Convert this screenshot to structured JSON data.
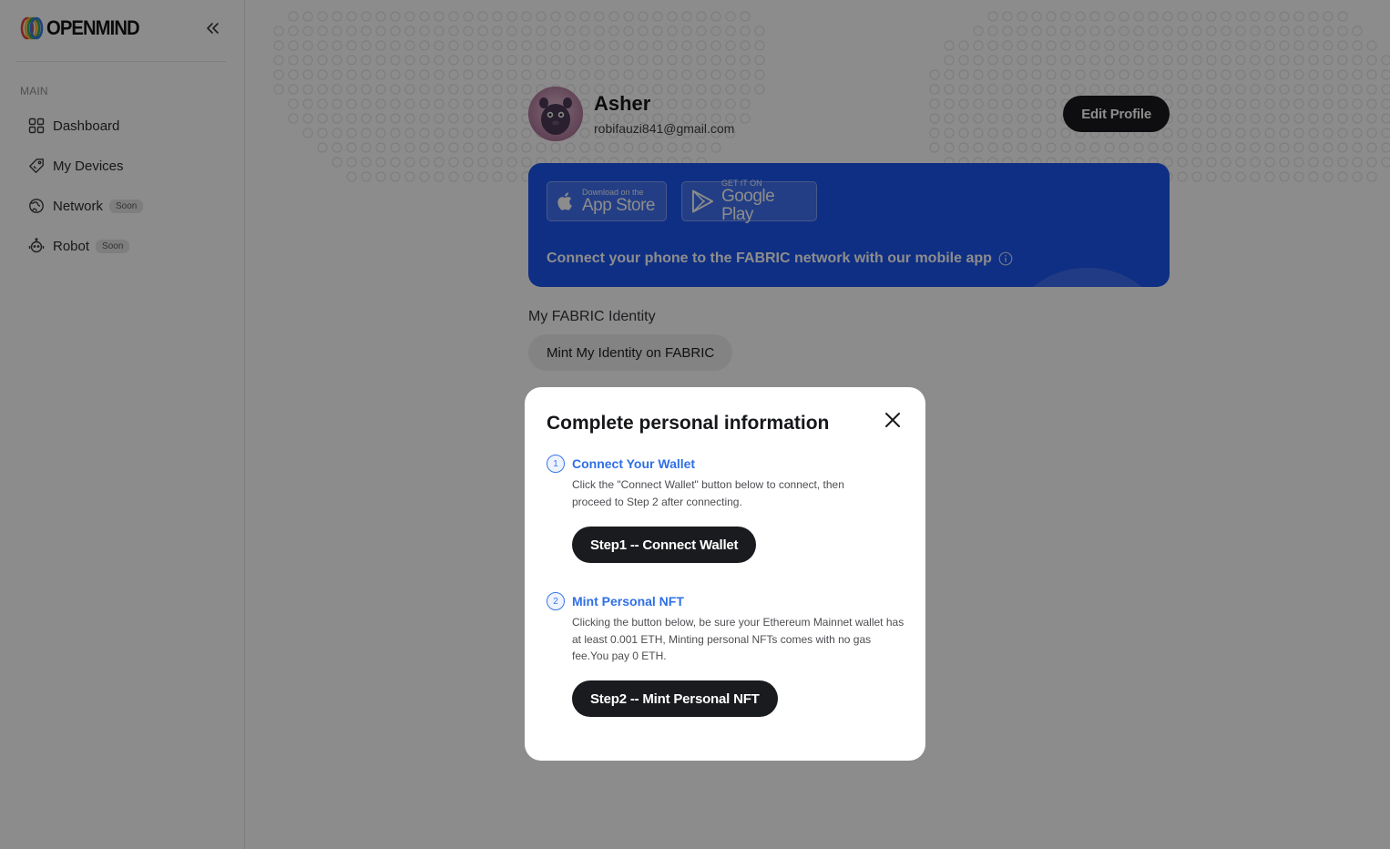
{
  "app": {
    "logo_text": "OPENMIND"
  },
  "sidebar": {
    "section_label": "MAIN",
    "items": [
      {
        "label": "Dashboard",
        "icon": "grid-icon"
      },
      {
        "label": "My Devices",
        "icon": "device-tag-icon"
      },
      {
        "label": "Network",
        "icon": "network-globe-icon",
        "badge": "Soon"
      },
      {
        "label": "Robot",
        "icon": "robot-icon",
        "badge": "Soon"
      }
    ]
  },
  "profile": {
    "name": "Asher",
    "email": "robifauzi841@gmail.com",
    "edit_label": "Edit Profile"
  },
  "app_banner": {
    "apple_small": "Download on the",
    "apple_big": "App Store",
    "google_small": "GET IT ON",
    "google_big": "Google Play",
    "text": "Connect your phone to the FABRIC network with our mobile app",
    "color": "#1d57f0"
  },
  "identity": {
    "title": "My FABRIC Identity",
    "mint_button": "Mint My Identity on FABRIC"
  },
  "modal": {
    "title": "Complete personal information",
    "steps": [
      {
        "number": "1",
        "title": "Connect Your Wallet",
        "description": "Click the \"Connect Wallet\" button below to connect, then proceed to Step 2 after connecting.",
        "button": "Step1 -- Connect Wallet"
      },
      {
        "number": "2",
        "title": "Mint Personal NFT",
        "description": "Clicking the button below, be sure your Ethereum Mainnet wallet has at least 0.001 ETH, Minting personal NFTs comes with no gas fee.You pay 0 ETH.",
        "button": "Step2 -- Mint Personal NFT"
      }
    ]
  }
}
